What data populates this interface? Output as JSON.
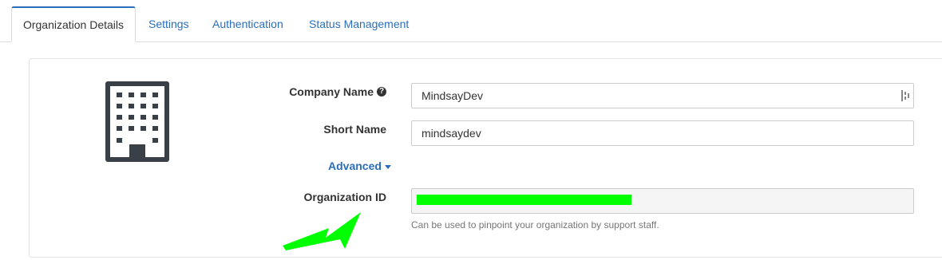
{
  "tabs": [
    {
      "label": "Organization Details"
    },
    {
      "label": "Settings"
    },
    {
      "label": "Authentication"
    },
    {
      "label": "Status Management"
    }
  ],
  "form": {
    "company_name_label": "Company Name",
    "company_name_value": "MindsayDev",
    "short_name_label": "Short Name",
    "short_name_value": "mindsaydev",
    "advanced_label": "Advanced",
    "org_id_label": "Organization ID",
    "org_id_value": "",
    "org_id_help": "Can be used to pinpoint your organization by support staff."
  },
  "icons": {
    "org": "building-icon",
    "help": "question-circle-icon",
    "password_manager": "password-manager-icon",
    "caret": "caret-down-icon",
    "annotation": "arrow-annotation"
  },
  "colors": {
    "link": "#2a6ebb",
    "annotation": "#00ff00"
  }
}
